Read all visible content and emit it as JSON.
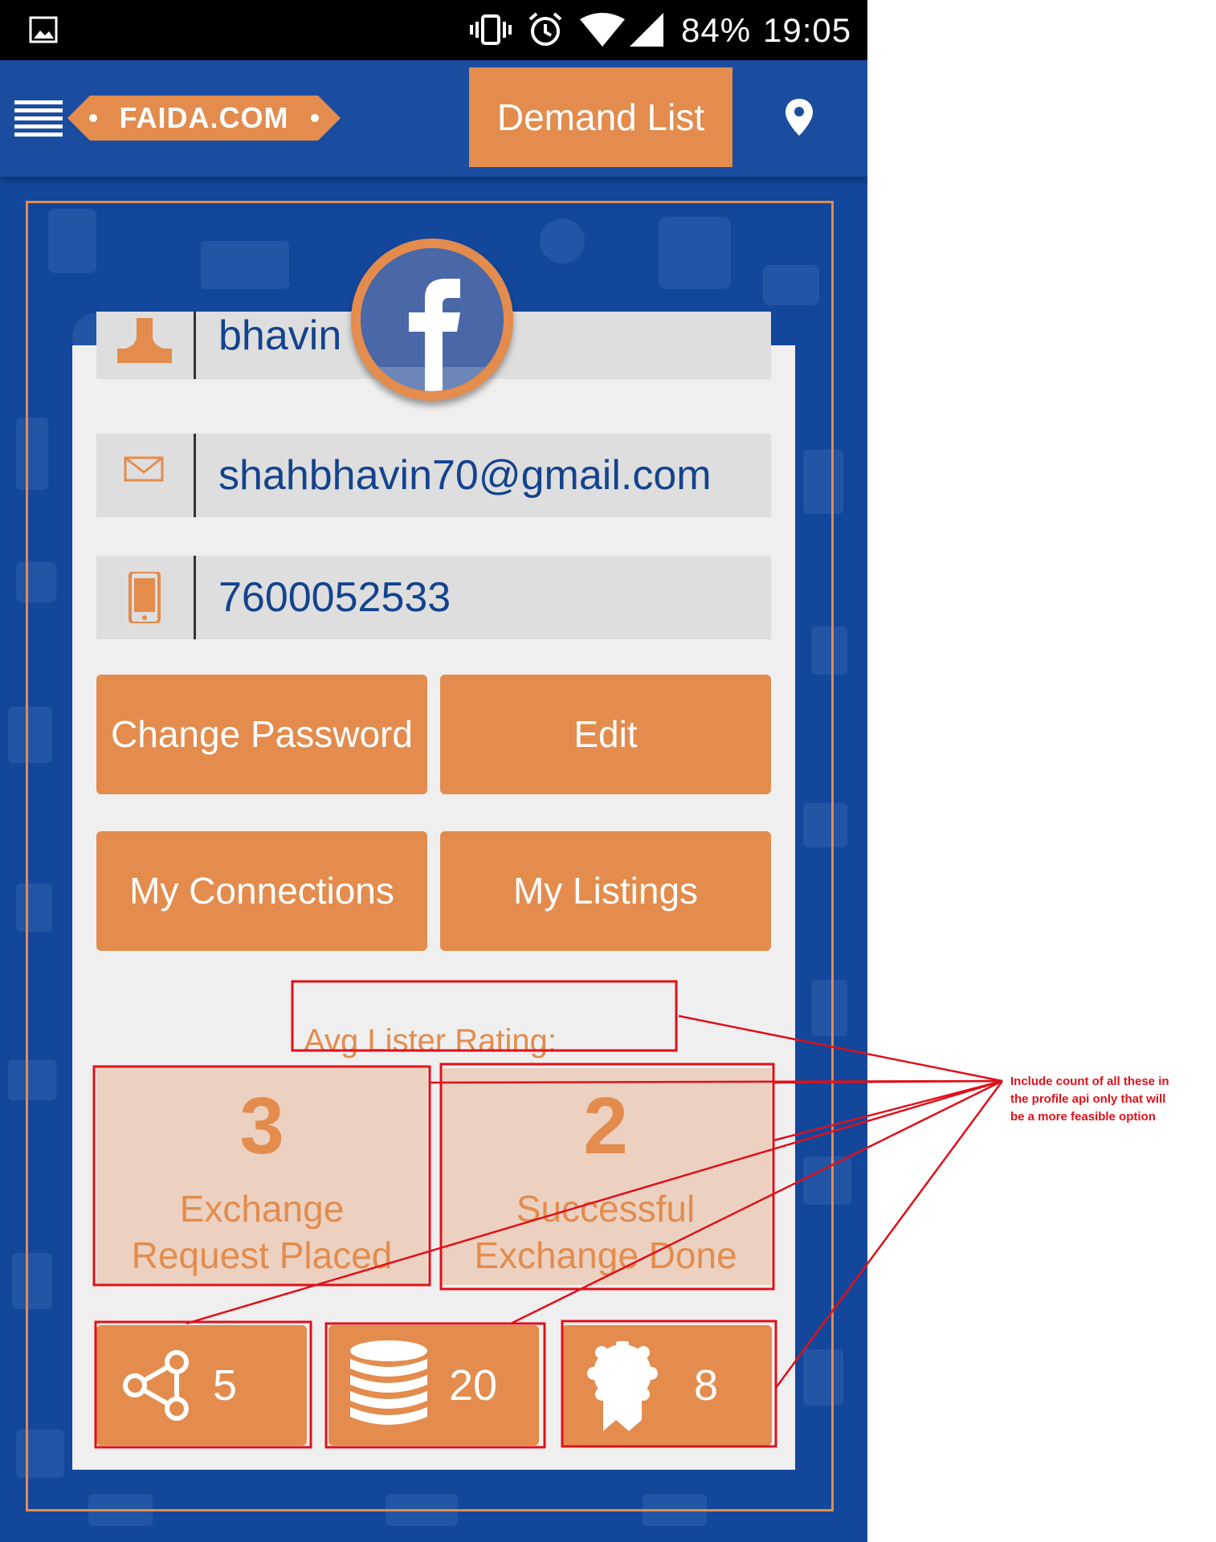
{
  "status_bar": {
    "battery": "84%",
    "time": "19:05",
    "icons": [
      "image-icon",
      "vibrate-icon",
      "alarm-icon",
      "wifi-icon",
      "signal-icon"
    ]
  },
  "app_bar": {
    "logo_text": "FAIDA.COM",
    "demand_list_label": "Demand List",
    "icons": [
      "menu-icon",
      "location-pin-icon"
    ]
  },
  "profile": {
    "name": "bhavin",
    "email": "shahbhavin70@gmail.com",
    "phone": "7600052533",
    "badge": "facebook-icon"
  },
  "actions": {
    "change_password": "Change Password",
    "edit": "Edit",
    "my_connections": "My Connections",
    "my_listings": "My Listings"
  },
  "rating": {
    "label": "Avg Lister Rating:"
  },
  "stats": [
    {
      "value": "3",
      "line1": "Exchange",
      "line2": "Request Placed"
    },
    {
      "value": "2",
      "line1": "Successful",
      "line2": "Exchange Done"
    }
  ],
  "counters": [
    {
      "icon": "share-icon",
      "value": "5"
    },
    {
      "icon": "coins-icon",
      "value": "20"
    },
    {
      "icon": "badge-ribbon-icon",
      "value": "8"
    }
  ],
  "annotation": {
    "note": "Include count of all these in the profile api only that will be a more feasible option",
    "color": "#e0101a"
  },
  "colors": {
    "brand_blue": "#12479b",
    "accent_orange": "#e38c4d",
    "card_bg": "#efefef",
    "field_bg": "#dedede",
    "stat_bg": "#ecd1c1",
    "text_blue": "#13438e"
  }
}
